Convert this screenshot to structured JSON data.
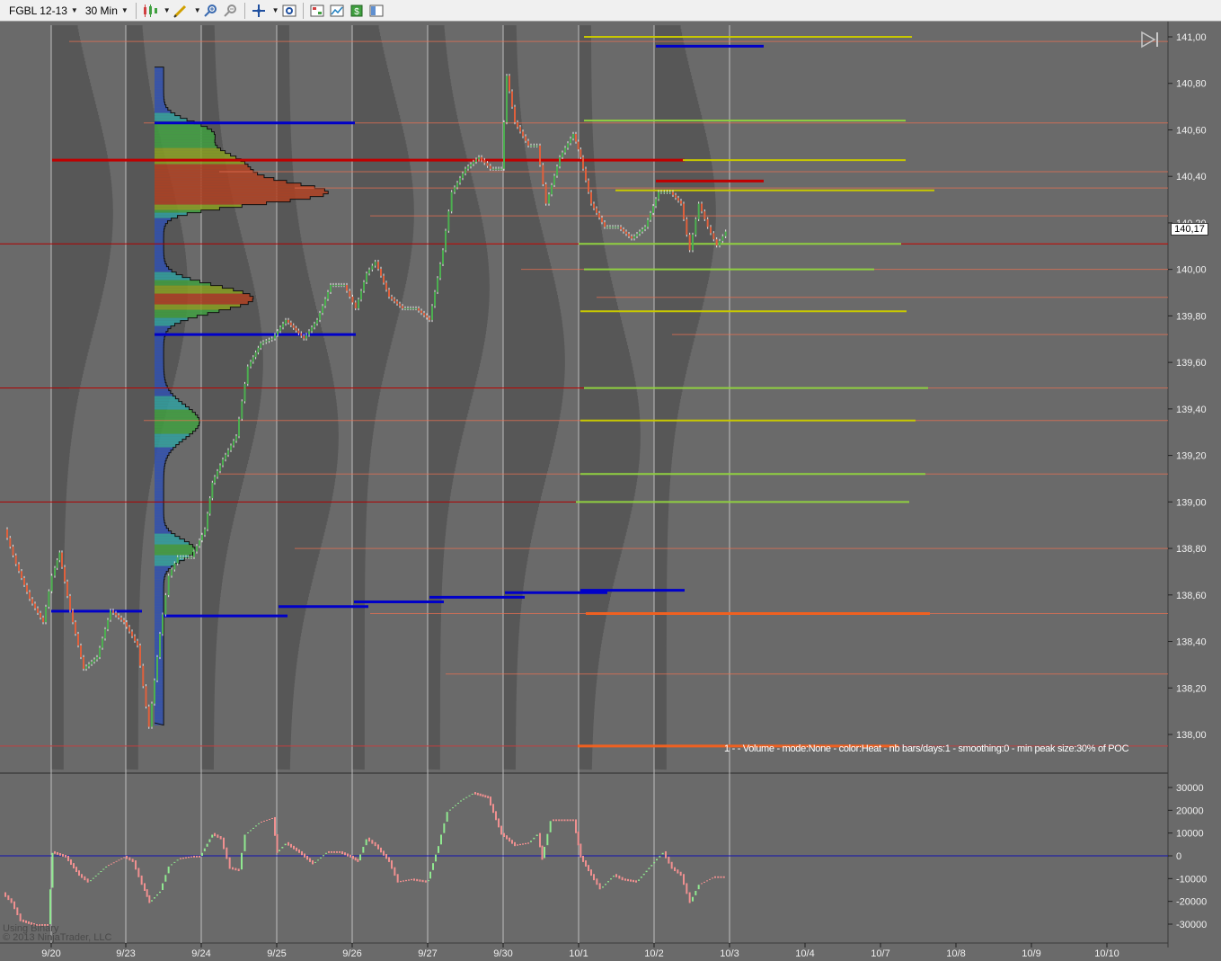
{
  "toolbar": {
    "instrument": "FGBL 12-13",
    "interval": "30 Min",
    "icons": [
      "candlestick-icon",
      "pencil-icon",
      "zoom-in-icon",
      "zoom-out-icon",
      "crosshair-icon",
      "properties-icon",
      "strategy-icon",
      "chart-style-icon",
      "money-icon",
      "template-icon"
    ]
  },
  "chart": {
    "current_price": "140,17",
    "price_ticks": [
      "141,00",
      "140,80",
      "140,60",
      "140,40",
      "140,20",
      "140,00",
      "139,80",
      "139,60",
      "139,40",
      "139,20",
      "139,00",
      "138,80",
      "138,60",
      "138,40",
      "138,20",
      "138,00"
    ],
    "volume_ticks": [
      "30000",
      "20000",
      "10000",
      "0",
      "-10000",
      "-20000",
      "-30000"
    ],
    "date_labels": [
      "9/20",
      "9/23",
      "9/24",
      "9/25",
      "9/26",
      "9/27",
      "9/30",
      "10/1",
      "10/2",
      "10/3",
      "10/4",
      "10/7",
      "10/8",
      "10/9",
      "10/10"
    ],
    "indicator_label": "1 -  - Volume - mode:None - color:Heat - nb bars/days:1 - smoothing:0 - min peak size:30% of POC",
    "watermark_line1": "Using Binary",
    "watermark_line2": "© 2013 NinjaTrader, LLC"
  },
  "colors": {
    "background": "#6a6a6a",
    "profile": "#5a5a5a",
    "up_candle": "#4caf50",
    "down_candle": "#e0603c",
    "poc_line": "#c00000",
    "value_line": "#0000c8",
    "level_yellow": "#c8c800",
    "level_green": "#90d040",
    "level_orange": "#f07050"
  }
}
